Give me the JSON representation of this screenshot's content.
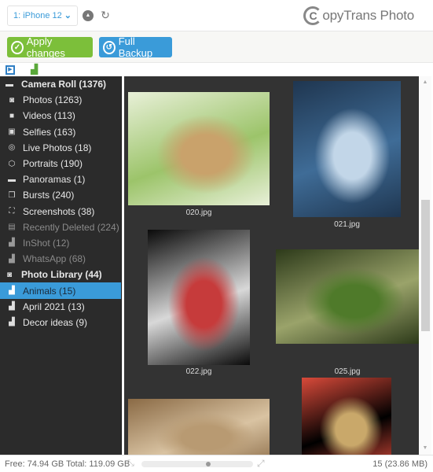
{
  "topbar": {
    "device_selected": "1: iPhone 12",
    "eject_icon": "eject-icon",
    "refresh_icon": "refresh-icon",
    "logo_text": "opyTrans Photo",
    "logo_mark": "C"
  },
  "actions": {
    "apply_label": "Apply changes",
    "backup_label": "Full Backup"
  },
  "sidebar": {
    "items": [
      {
        "label": "Camera Roll (1376)",
        "icon": "camera-roll-icon",
        "glyph": "▬",
        "kind": "header"
      },
      {
        "label": "Photos (1263)",
        "icon": "camera-icon",
        "glyph": "◙",
        "kind": "normal"
      },
      {
        "label": "Videos (113)",
        "icon": "video-icon",
        "glyph": "■",
        "kind": "normal"
      },
      {
        "label": "Selfies (163)",
        "icon": "selfie-icon",
        "glyph": "▣",
        "kind": "normal"
      },
      {
        "label": "Live Photos (18)",
        "icon": "live-photo-icon",
        "glyph": "◎",
        "kind": "normal"
      },
      {
        "label": "Portraits (190)",
        "icon": "cube-icon",
        "glyph": "⬡",
        "kind": "normal"
      },
      {
        "label": "Panoramas (1)",
        "icon": "panorama-icon",
        "glyph": "▬",
        "kind": "normal"
      },
      {
        "label": "Bursts (240)",
        "icon": "bursts-icon",
        "glyph": "❒",
        "kind": "normal"
      },
      {
        "label": "Screenshots (38)",
        "icon": "screenshot-icon",
        "glyph": "⛶",
        "kind": "normal"
      },
      {
        "label": "Recently Deleted (224)",
        "icon": "trash-icon",
        "glyph": "▤",
        "kind": "dim"
      },
      {
        "label": "InShot (12)",
        "icon": "album-icon",
        "glyph": "▟",
        "kind": "dim"
      },
      {
        "label": "WhatsApp (68)",
        "icon": "album-icon",
        "glyph": "▟",
        "kind": "dim"
      },
      {
        "label": "Photo Library (44)",
        "icon": "camera-icon",
        "glyph": "◙",
        "kind": "header"
      },
      {
        "label": "Animals (15)",
        "icon": "album-icon",
        "glyph": "▟",
        "kind": "active"
      },
      {
        "label": "April 2021 (13)",
        "icon": "album-icon",
        "glyph": "▟",
        "kind": "normal"
      },
      {
        "label": "Decor ideas (9)",
        "icon": "album-icon",
        "glyph": "▟",
        "kind": "normal"
      }
    ]
  },
  "gallery": {
    "photos": [
      {
        "name": "020.jpg",
        "subject": "monkeys",
        "colors": [
          "#9cc46a",
          "#c9a26b",
          "#e8f0d8"
        ]
      },
      {
        "name": "021.jpg",
        "subject": "cormorant",
        "colors": [
          "#3f6c97",
          "#c2d6e8",
          "#1f3650"
        ]
      },
      {
        "name": "022.jpg",
        "subject": "pelican",
        "colors": [
          "#d8d8d8",
          "#c63b3b",
          "#0a0a0a"
        ]
      },
      {
        "name": "025.jpg",
        "subject": "iguana",
        "colors": [
          "#9aa36a",
          "#4f7a2a",
          "#2d3a1a"
        ]
      },
      {
        "name": "",
        "subject": "meerkats",
        "colors": [
          "#d9c3a2",
          "#b89a72",
          "#8a6a45"
        ]
      },
      {
        "name": "",
        "subject": "crowned crane",
        "colors": [
          "#000000",
          "#c9a86a",
          "#d94a3a"
        ]
      }
    ]
  },
  "scroll": {
    "position_fraction": 0.5,
    "visible_fraction": 0.37
  },
  "status": {
    "free_total": "Free: 74.94 GB Total: 119.09 GB",
    "zoom_fraction": 0.6,
    "count_size": "15 (23.86 MB)"
  }
}
